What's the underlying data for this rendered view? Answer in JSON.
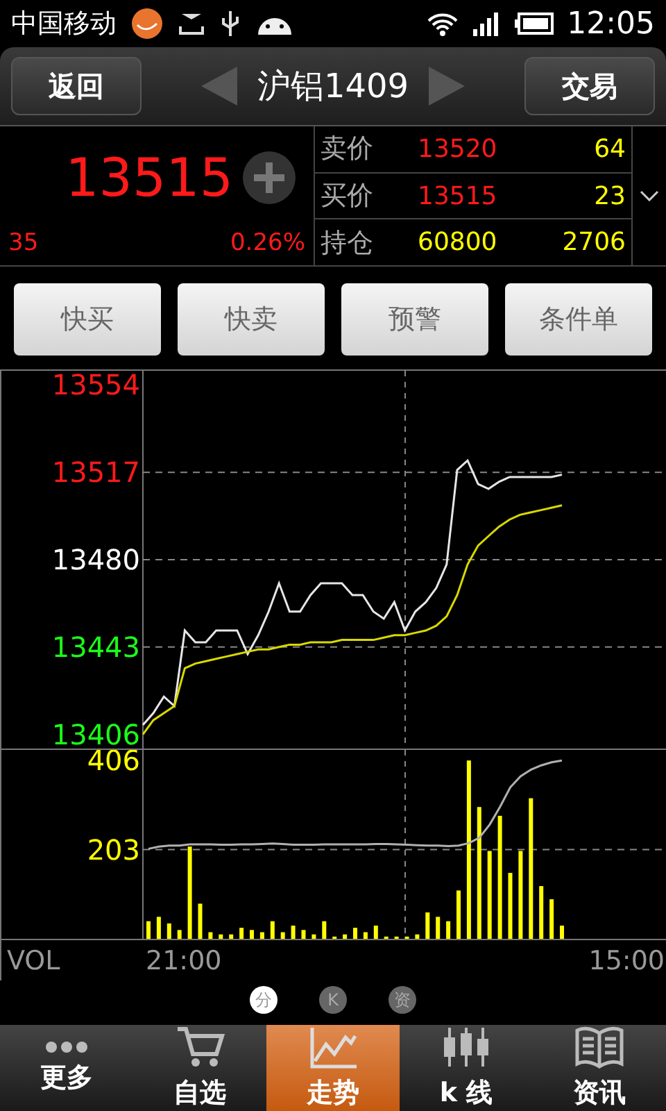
{
  "status_bar": {
    "carrier": "中国移动",
    "time": "12:05"
  },
  "header": {
    "back": "返回",
    "title": "沪铝1409",
    "trade": "交易"
  },
  "quote": {
    "price": "13515",
    "change": "35",
    "change_pct": "0.26%",
    "rows": [
      {
        "label": "卖价",
        "value": "13520",
        "color": "#ff1a1a",
        "amount": "64"
      },
      {
        "label": "买价",
        "value": "13515",
        "color": "#ff1a1a",
        "amount": "23"
      },
      {
        "label": "持仓",
        "value": "60800",
        "color": "#ffff00",
        "amount": "2706"
      }
    ]
  },
  "actions": [
    "快买",
    "快卖",
    "预警",
    "条件单"
  ],
  "price_chart": {
    "chart_data": {
      "type": "line",
      "grid": true,
      "categories": [
        null,
        null,
        null,
        null,
        null,
        null,
        null,
        null,
        null,
        null,
        null,
        null,
        null,
        null,
        null,
        null,
        null,
        null,
        null,
        null,
        null,
        null,
        null,
        null,
        null,
        null,
        null,
        null,
        null,
        null,
        null,
        null,
        null,
        null,
        null,
        null,
        null,
        null,
        null,
        null,
        null
      ],
      "ylim": [
        13400,
        13560
      ],
      "yticks": [
        13554,
        13517,
        13480,
        13443,
        13406
      ],
      "series": [
        {
          "color": "#e6e6e6",
          "values": [
            13410,
            13415,
            13422,
            13418,
            13450,
            13445,
            13445,
            13450,
            13450,
            13450,
            13440,
            13448,
            13458,
            13470,
            13458,
            13458,
            13465,
            13470,
            13470,
            13470,
            13465,
            13465,
            13458,
            13455,
            13462,
            13450,
            13458,
            13462,
            13468,
            13478,
            13518,
            13522,
            13512,
            13510,
            13513,
            13515,
            13515,
            13515,
            13515,
            13515,
            13516
          ]
        },
        {
          "color": "#d8d800",
          "values": [
            13406,
            13412,
            13415,
            13418,
            13434,
            13436,
            13437,
            13438,
            13439,
            13440,
            13441,
            13442,
            13442,
            13443,
            13444,
            13444,
            13445,
            13445,
            13445,
            13446,
            13446,
            13446,
            13446,
            13447,
            13448,
            13448,
            13449,
            13450,
            13452,
            13456,
            13465,
            13478,
            13486,
            13490,
            13494,
            13497,
            13499,
            13500,
            13501,
            13502,
            13503
          ]
        }
      ]
    }
  },
  "volume_chart": {
    "time_labels": [
      "21:00",
      "15:00"
    ],
    "chart_data": {
      "type": "bar",
      "grid": true,
      "categories": [
        null,
        null,
        null,
        null,
        null,
        null,
        null,
        null,
        null,
        null,
        null,
        null,
        null,
        null,
        null,
        null,
        null,
        null,
        null,
        null,
        null,
        null,
        null,
        null,
        null,
        null,
        null,
        null,
        null,
        null,
        null,
        null,
        null,
        null,
        null,
        null,
        null,
        null,
        null,
        null,
        null
      ],
      "ylim": [
        0,
        430
      ],
      "yticks": [
        406,
        203
      ],
      "series": [
        {
          "name": "VOL",
          "color": "#ffff00",
          "values": [
            40,
            50,
            35,
            20,
            210,
            80,
            15,
            10,
            10,
            25,
            20,
            15,
            40,
            15,
            30,
            20,
            10,
            40,
            5,
            10,
            25,
            15,
            30,
            5,
            5,
            5,
            10,
            60,
            50,
            40,
            110,
            406,
            300,
            200,
            280,
            150,
            200,
            320,
            120,
            90,
            30
          ]
        },
        {
          "type": "line",
          "color": "#b0b0b0",
          "values": [
            205,
            210,
            212,
            212,
            215,
            215,
            215,
            214,
            214,
            215,
            215,
            216,
            217,
            216,
            214,
            214,
            214,
            215,
            215,
            215,
            215,
            215,
            216,
            216,
            215,
            214,
            213,
            212,
            212,
            211,
            212,
            218,
            230,
            260,
            300,
            345,
            370,
            385,
            395,
            402,
            406
          ]
        }
      ]
    }
  },
  "pages": [
    {
      "label": "分",
      "selected": true
    },
    {
      "label": "K",
      "selected": false
    },
    {
      "label": "资",
      "selected": false
    }
  ],
  "nav": [
    {
      "kind": "more",
      "label": "更多",
      "selected": false
    },
    {
      "kind": "cart",
      "label": "自选",
      "selected": false
    },
    {
      "kind": "trend",
      "label": "走势",
      "selected": true
    },
    {
      "kind": "candles",
      "label": "k 线",
      "selected": false
    },
    {
      "kind": "book",
      "label": "资讯",
      "selected": false
    }
  ]
}
